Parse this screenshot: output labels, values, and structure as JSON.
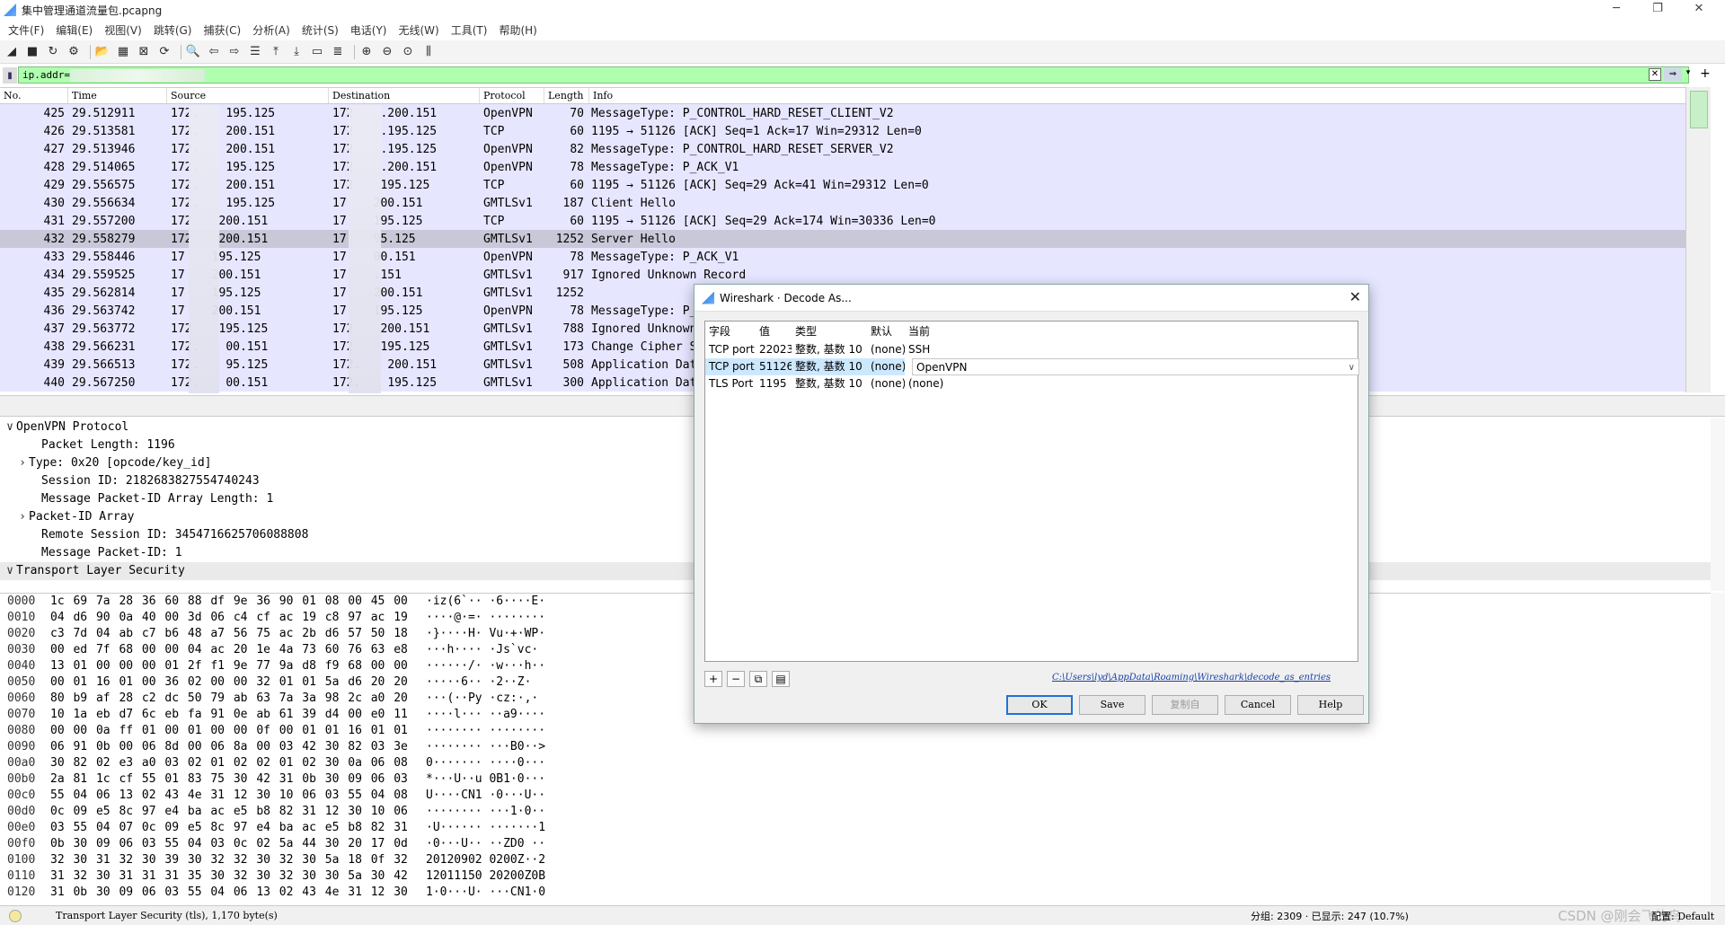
{
  "window": {
    "title": "集中管理通道流量包.pcapng",
    "min": "─",
    "max": "❐",
    "close": "✕"
  },
  "menu": [
    "文件(F)",
    "编辑(E)",
    "视图(V)",
    "跳转(G)",
    "捕获(C)",
    "分析(A)",
    "统计(S)",
    "电话(Y)",
    "无线(W)",
    "工具(T)",
    "帮助(H)"
  ],
  "filter": {
    "value": "ip.addr=",
    "clear": "✕",
    "apply": "⇒",
    "dropdown": "▾",
    "add": "+"
  },
  "columns": {
    "no": "No.",
    "time": "Time",
    "source": "Source",
    "destination": "Destination",
    "protocol": "Protocol",
    "length": "Length",
    "info": "Info"
  },
  "packets": [
    {
      "no": "425",
      "time": "29.512911",
      "src": "172.",
      "src2": "195.125",
      "dst": "172",
      "dst2": ".200.151",
      "proto": "OpenVPN",
      "len": "70",
      "info": "MessageType: P_CONTROL_HARD_RESET_CLIENT_V2"
    },
    {
      "no": "426",
      "time": "29.513581",
      "src": "172.",
      "src2": "200.151",
      "dst": "172",
      "dst2": ".195.125",
      "proto": "TCP",
      "len": "60",
      "info": "1195 → 51126 [ACK] Seq=1 Ack=17 Win=29312 Len=0"
    },
    {
      "no": "427",
      "time": "29.513946",
      "src": "172.",
      "src2": "200.151",
      "dst": "172",
      "dst2": ".195.125",
      "proto": "OpenVPN",
      "len": "82",
      "info": "MessageType: P_CONTROL_HARD_RESET_SERVER_V2"
    },
    {
      "no": "428",
      "time": "29.514065",
      "src": "172.",
      "src2": "195.125",
      "dst": "172",
      "dst2": ".200.151",
      "proto": "OpenVPN",
      "len": "78",
      "info": "MessageType: P_ACK_V1"
    },
    {
      "no": "429",
      "time": "29.556575",
      "src": "172.",
      "src2": "200.151",
      "dst": "172",
      "dst2": "195.125",
      "proto": "TCP",
      "len": "60",
      "info": "1195 → 51126 [ACK] Seq=29 Ack=41 Win=29312 Len=0"
    },
    {
      "no": "430",
      "time": "29.556634",
      "src": "172.",
      "src2": "195.125",
      "dst": "17",
      "dst2": "200.151",
      "proto": "GMTLSv1",
      "len": "187",
      "info": "Client Hello"
    },
    {
      "no": "431",
      "time": "29.557200",
      "src": "172",
      "src2": "200.151",
      "dst": "17",
      "dst2": "195.125",
      "proto": "TCP",
      "len": "60",
      "info": "1195 → 51126 [ACK] Seq=29 Ack=174 Win=30336 Len=0"
    },
    {
      "no": "432",
      "time": "29.558279",
      "src": "172",
      "src2": "200.151",
      "dst": "17",
      "dst2": "95.125",
      "proto": "GMTLSv1",
      "len": "1252",
      "info": "Server Hello"
    },
    {
      "no": "433",
      "time": "29.558446",
      "src": "17",
      "src2": "195.125",
      "dst": "17",
      "dst2": "00.151",
      "proto": "OpenVPN",
      "len": "78",
      "info": "MessageType: P_ACK_V1"
    },
    {
      "no": "434",
      "time": "29.559525",
      "src": "17",
      "src2": "200.151",
      "dst": "17",
      "dst2": ".151",
      "proto": "GMTLSv1",
      "len": "917",
      "info": "Ignored Unknown Record"
    },
    {
      "no": "435",
      "time": "29.562814",
      "src": "17",
      "src2": "195.125",
      "dst": "17",
      "dst2": "200.151",
      "proto": "GMTLSv1",
      "len": "1252",
      "info": ""
    },
    {
      "no": "436",
      "time": "29.563742",
      "src": "17",
      "src2": "200.151",
      "dst": "17",
      "dst2": "195.125",
      "proto": "OpenVPN",
      "len": "78",
      "info": "MessageType: P_A"
    },
    {
      "no": "437",
      "time": "29.563772",
      "src": "172",
      "src2": "195.125",
      "dst": "172",
      "dst2": "200.151",
      "proto": "GMTLSv1",
      "len": "788",
      "info": "Ignored Unknown"
    },
    {
      "no": "438",
      "time": "29.566231",
      "src": "172.",
      "src2": "00.151",
      "dst": "172",
      "dst2": "195.125",
      "proto": "GMTLSv1",
      "len": "173",
      "info": "Change Cipher Sp"
    },
    {
      "no": "439",
      "time": "29.566513",
      "src": "172.",
      "src2": "95.125",
      "dst": "172.",
      "dst2": "200.151",
      "proto": "GMTLSv1",
      "len": "508",
      "info": "Application Data"
    },
    {
      "no": "440",
      "time": "29.567250",
      "src": "172.",
      "src2": "00.151",
      "dst": "172.",
      "dst2": "195.125",
      "proto": "GMTLSv1",
      "len": "300",
      "info": "Application Data"
    }
  ],
  "details": [
    {
      "arrow": "∨",
      "indent": 0,
      "text": "OpenVPN Protocol"
    },
    {
      "arrow": "",
      "indent": 2,
      "text": "Packet Length: 1196"
    },
    {
      "arrow": "›",
      "indent": 1,
      "text": "Type: 0x20 [opcode/key_id]"
    },
    {
      "arrow": "",
      "indent": 2,
      "text": "Session ID: 2182683827554740243"
    },
    {
      "arrow": "",
      "indent": 2,
      "text": "Message Packet-ID Array Length: 1"
    },
    {
      "arrow": "›",
      "indent": 1,
      "text": "Packet-ID Array"
    },
    {
      "arrow": "",
      "indent": 2,
      "text": "Remote Session ID: 3454716625706088808"
    },
    {
      "arrow": "",
      "indent": 2,
      "text": "Message Packet-ID: 1"
    },
    {
      "arrow": "∨",
      "indent": 0,
      "text": "Transport Layer Security"
    }
  ],
  "hex": [
    {
      "off": "0000",
      "bytes": "1c 69 7a 28 36 60 88 df  9e 36 90 01 08 00 45 00",
      "ascii": "·iz(6`·· ·6····E·"
    },
    {
      "off": "0010",
      "bytes": "04 d6 90 0a 40 00 3d 06  c4 cf ac 19 c8 97 ac 19",
      "ascii": "····@·=· ········"
    },
    {
      "off": "0020",
      "bytes": "c3 7d 04 ab c7 b6 48 a7  56 75 ac 2b d6 57 50 18",
      "ascii": "·}····H· Vu·+·WP·"
    },
    {
      "off": "0030",
      "bytes": "00 ed 7f 68 00 00 04 ac  20 1e 4a 73 60 76 63 e8",
      "ascii": "···h····  ·Js`vc·"
    },
    {
      "off": "0040",
      "bytes": "13 01 00 00 00 01 2f f1  9e 77 9a d8 f9 68 00 00",
      "ascii": "······/· ·w···h··"
    },
    {
      "off": "0050",
      "bytes": "00 01 16 01 00 36 02 00  00 32 01 01 5a d6 20 20",
      "ascii": "·····6·· ·2··Z·  "
    },
    {
      "off": "0060",
      "bytes": "80 b9 af 28 c2 dc 50 79  ab 63 7a 3a 98 2c a0 20",
      "ascii": "···(··Py ·cz:·,· "
    },
    {
      "off": "0070",
      "bytes": "10 1a eb d7 6c eb fa 91  0e ab 61 39 d4 00 e0 11",
      "ascii": "····l··· ··a9····"
    },
    {
      "off": "0080",
      "bytes": "00 00 0a ff 01 00 01 00  00 0f 00 01 01 16 01 01",
      "ascii": "········ ········"
    },
    {
      "off": "0090",
      "bytes": "06 91 0b 00 06 8d 00 06  8a 00 03 42 30 82 03 3e",
      "ascii": "········ ···B0··>"
    },
    {
      "off": "00a0",
      "bytes": "30 82 02 e3 a0 03 02 01  02 02 01 02 30 0a 06 08",
      "ascii": "0······· ····0···"
    },
    {
      "off": "00b0",
      "bytes": "2a 81 1c cf 55 01 83 75  30 42 31 0b 30 09 06 03",
      "ascii": "*···U··u 0B1·0···"
    },
    {
      "off": "00c0",
      "bytes": "55 04 06 13 02 43 4e 31  12 30 10 06 03 55 04 08",
      "ascii": "U····CN1 ·0···U··"
    },
    {
      "off": "00d0",
      "bytes": "0c 09 e5 8c 97 e4 ba ac  e5 b8 82 31 12 30 10 06",
      "ascii": "········ ···1·0··"
    },
    {
      "off": "00e0",
      "bytes": "03 55 04 07 0c 09 e5 8c  97 e4 ba ac e5 b8 82 31",
      "ascii": "·U······ ·······1"
    },
    {
      "off": "00f0",
      "bytes": "0b 30 09 06 03 55 04 03  0c 02 5a 44 30 20 17 0d",
      "ascii": "·0···U·· ··ZD0 ··"
    },
    {
      "off": "0100",
      "bytes": "32 30 31 32 30 39 30 32  32 30 32 30 5a 18 0f 32",
      "ascii": "20120902 0200Z··2"
    },
    {
      "off": "0110",
      "bytes": "31 32 30 31 31 31 35 30  32 30 32 30 30 5a 30 42",
      "ascii": "12011150 20200Z0B"
    },
    {
      "off": "0120",
      "bytes": "31 0b 30 09 06 03 55 04  06 13 02 43 4e 31 12 30",
      "ascii": "1·0···U· ···CN1·0"
    }
  ],
  "status": {
    "text": "Transport Layer Security (tls), 1,170 byte(s)",
    "packets": "分组: 2309 · 已显示: 247 (10.7%)",
    "watermark": "CSDN @刚会飞的鸟",
    "profile": "配置: Default"
  },
  "dialog": {
    "title": "Wireshark · Decode As...",
    "close": "✕",
    "headers": {
      "field": "字段",
      "value": "值",
      "type": "类型",
      "default": "默认",
      "current": "当前"
    },
    "rows": [
      {
        "field": "TCP port",
        "value": "22023",
        "type": "整数, 基数 10",
        "default": "(none)",
        "current": "SSH"
      },
      {
        "field": "TCP port",
        "value": "51126",
        "type": "整数, 基数 10",
        "default": "(none)",
        "current": "OpenVPN"
      },
      {
        "field": "TLS Port",
        "value": "1195",
        "type": "整数, 基数 10",
        "default": "(none)",
        "current": "(none)"
      }
    ],
    "path": "C:\\Users\\lyd\\AppData\\Roaming\\Wireshark\\decode_as_entries",
    "tools": [
      "+",
      "−",
      "⧉",
      "▤"
    ],
    "buttons": {
      "ok": "OK",
      "save": "Save",
      "copy_from": "复制自",
      "cancel": "Cancel",
      "help": "Help"
    }
  }
}
